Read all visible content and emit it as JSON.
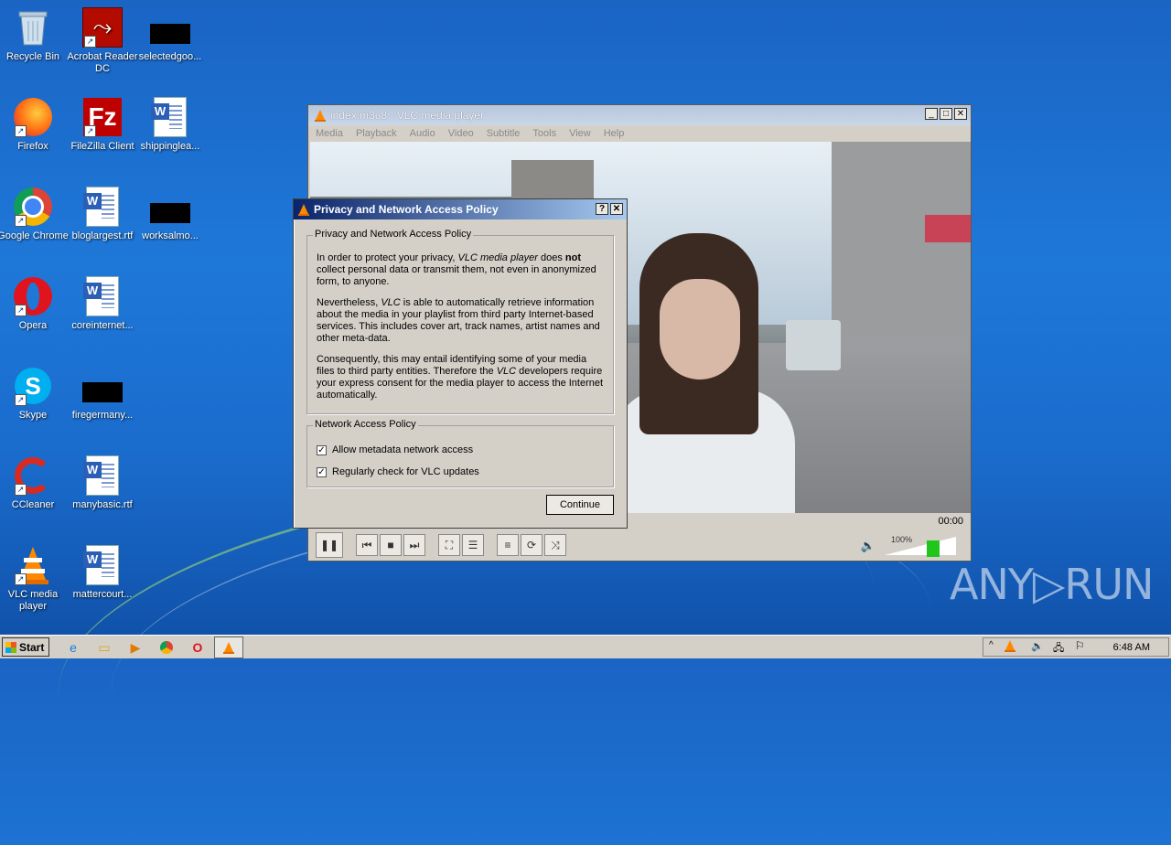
{
  "desktop": {
    "icons": [
      {
        "label": "Recycle Bin",
        "icon": "recycle-bin-icon"
      },
      {
        "label": "Acrobat Reader DC",
        "icon": "acrobat-icon"
      },
      {
        "label": "selectedgoo...",
        "icon": "blank-file-icon"
      },
      {
        "label": "Firefox",
        "icon": "firefox-icon"
      },
      {
        "label": "FileZilla Client",
        "icon": "filezilla-icon"
      },
      {
        "label": "shippinglea...",
        "icon": "word-doc-icon"
      },
      {
        "label": "Google Chrome",
        "icon": "chrome-icon"
      },
      {
        "label": "bloglargest.rtf",
        "icon": "word-doc-icon"
      },
      {
        "label": "worksalmo...",
        "icon": "blank-file-icon"
      },
      {
        "label": "Opera",
        "icon": "opera-icon"
      },
      {
        "label": "coreinternet...",
        "icon": "word-doc-icon"
      },
      {
        "label": "Skype",
        "icon": "skype-icon"
      },
      {
        "label": "firegermany...",
        "icon": "blank-file-icon"
      },
      {
        "label": "CCleaner",
        "icon": "ccleaner-icon"
      },
      {
        "label": "manybasic.rtf",
        "icon": "word-doc-icon"
      },
      {
        "label": "VLC media player",
        "icon": "vlc-icon"
      },
      {
        "label": "mattercourt...",
        "icon": "word-doc-icon"
      }
    ]
  },
  "vlc": {
    "title": "index.m3u8 - VLC media player",
    "menu": [
      "Media",
      "Playback",
      "Audio",
      "Video",
      "Subtitle",
      "Tools",
      "View",
      "Help"
    ],
    "time": "00:00",
    "volume": "100%",
    "volume_level": 1.0
  },
  "dialog": {
    "title": "Privacy and Network Access Policy",
    "help_btn": "?",
    "close_btn": "✕",
    "group1_title": "Privacy and Network Access Policy",
    "p1_a": "In order to protect your privacy, ",
    "p1_b": "VLC media player",
    "p1_c": " does ",
    "p1_d": "not",
    "p1_e": " collect personal data or transmit them, not even in anonymized form, to anyone.",
    "p2_a": "Nevertheless, ",
    "p2_b": "VLC",
    "p2_c": " is able to automatically retrieve information about the media in your playlist from third party Internet-based services. This includes cover art, track names, artist names and other meta-data.",
    "p3_a": "Consequently, this may entail identifying some of your media files to third party entities. Therefore the ",
    "p3_b": "VLC",
    "p3_c": " developers require your express consent for the media player to access the Internet automatically.",
    "group2_title": "Network Access Policy",
    "chk1": "Allow metadata network access",
    "chk2": "Regularly check for VLC updates",
    "continue": "Continue"
  },
  "taskbar": {
    "start": "Start",
    "clock": "6:48 AM"
  },
  "watermark": "ANY▷RUN"
}
